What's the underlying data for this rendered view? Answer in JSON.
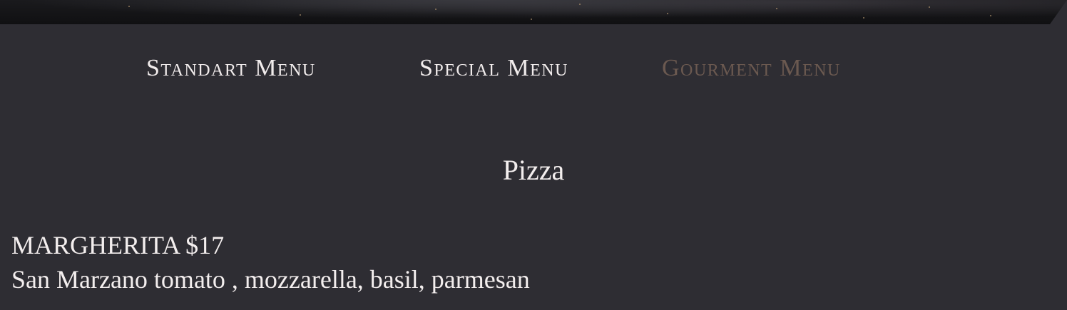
{
  "nav": {
    "tabs": [
      {
        "label": "Standart Menu",
        "active": false
      },
      {
        "label": "Special Menu",
        "active": false
      },
      {
        "label": "Gourment Menu",
        "active": true
      }
    ],
    "active_tab_color": "#6b5950",
    "inactive_tab_color": "#f1ecec"
  },
  "section": {
    "title": "Pizza"
  },
  "items": [
    {
      "name": "MARGHERITA",
      "price": "$17",
      "description": "San Marzano tomato , mozzarella, basil, parmesan"
    }
  ],
  "colors": {
    "background": "#2e2d33",
    "text": "#f3eeee"
  }
}
